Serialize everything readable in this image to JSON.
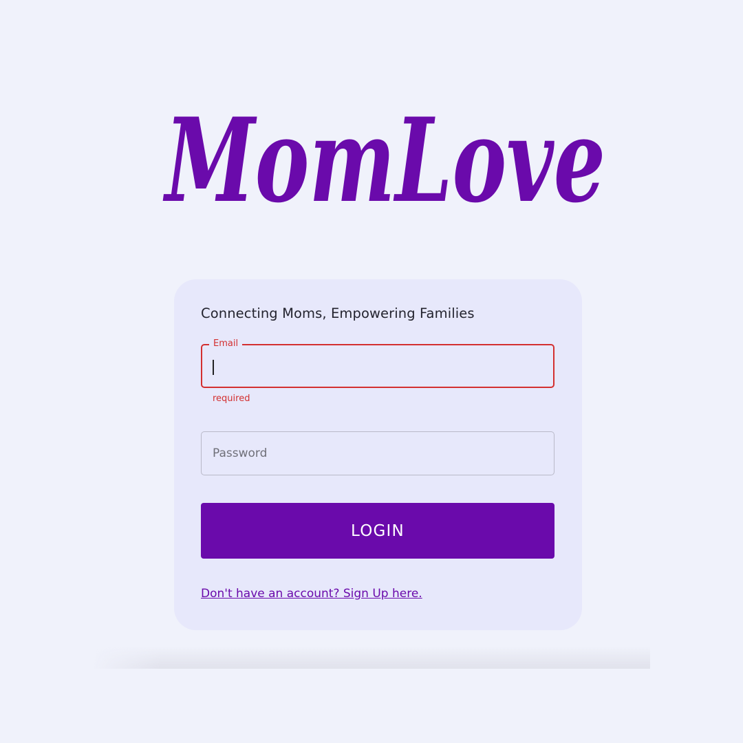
{
  "brand": {
    "logo_text": "MomLove",
    "logo_color": "#6a0aab"
  },
  "login_card": {
    "tagline": "Connecting Moms, Empowering Families",
    "email": {
      "label": "Email",
      "value": "",
      "helper_text": "required",
      "error_color": "#d32f2f"
    },
    "password": {
      "placeholder": "Password",
      "value": ""
    },
    "login_button": {
      "label": "LOGIN",
      "color": "#6a0aab"
    },
    "signup_link": "Don't have an account? Sign Up here."
  }
}
